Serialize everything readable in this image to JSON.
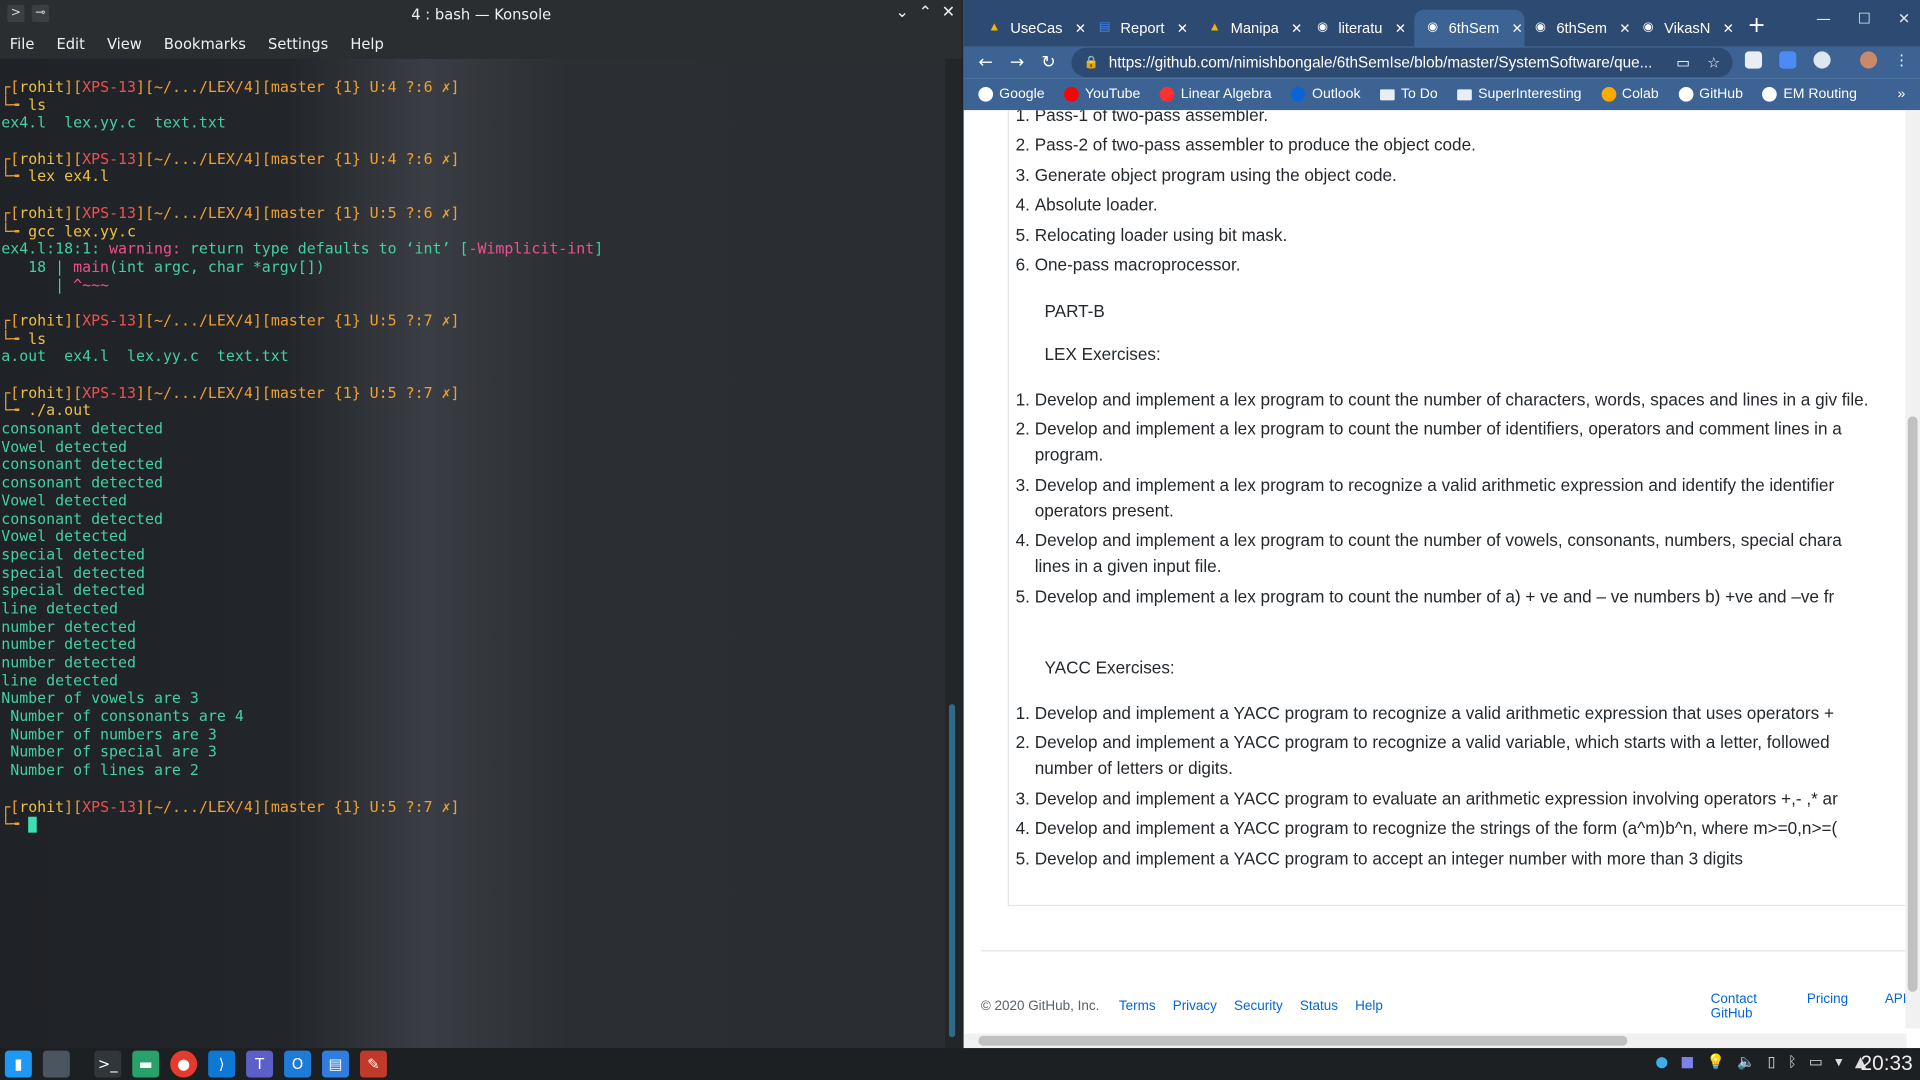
{
  "konsole": {
    "title": "4 : bash — Konsole",
    "menu": [
      "File",
      "Edit",
      "View",
      "Bookmarks",
      "Settings",
      "Help"
    ],
    "prompt": {
      "user": "rohit",
      "host": "XPS-13",
      "path": "~/.../LEX/4",
      "branch_prefix": "master {1}"
    },
    "blocks": [
      {
        "git": "U:4 ?:6",
        "cmd": "ls",
        "output": [
          {
            "t": "ex4.l  lex.yy.c  text.txt",
            "c": "c-grn"
          }
        ]
      },
      {
        "git": "U:4 ?:6",
        "cmd": "lex ex4.l",
        "output": []
      },
      {
        "git": "U:5 ?:6",
        "cmd": "gcc lex.yy.c",
        "output": []
      },
      {
        "git": "U:5 ?:7",
        "cmd": "ls",
        "output": [
          {
            "t": "a.out  ex4.l  lex.yy.c  text.txt",
            "c": "c-grn"
          }
        ]
      },
      {
        "git": "U:5 ?:7",
        "cmd": "./a.out",
        "output": [
          {
            "t": "consonant detected",
            "c": "c-grn"
          },
          {
            "t": "Vowel detected",
            "c": "c-grn"
          },
          {
            "t": "consonant detected",
            "c": "c-grn"
          },
          {
            "t": "consonant detected",
            "c": "c-grn"
          },
          {
            "t": "Vowel detected",
            "c": "c-grn"
          },
          {
            "t": "consonant detected",
            "c": "c-grn"
          },
          {
            "t": "Vowel detected",
            "c": "c-grn"
          },
          {
            "t": "special detected",
            "c": "c-grn"
          },
          {
            "t": "special detected",
            "c": "c-grn"
          },
          {
            "t": "special detected",
            "c": "c-grn"
          },
          {
            "t": "line detected",
            "c": "c-grn"
          },
          {
            "t": "number detected",
            "c": "c-grn"
          },
          {
            "t": "number detected",
            "c": "c-grn"
          },
          {
            "t": "number detected",
            "c": "c-grn"
          },
          {
            "t": "line detected",
            "c": "c-grn"
          },
          {
            "t": "Number of vowels are 3",
            "c": "c-grn"
          },
          {
            "t": " Number of consonants are 4",
            "c": "c-grn"
          },
          {
            "t": " Number of numbers are 3",
            "c": "c-grn"
          },
          {
            "t": " Number of special are 3",
            "c": "c-grn"
          },
          {
            "t": " Number of lines are 2",
            "c": "c-grn"
          }
        ]
      },
      {
        "git": "U:5 ?:7",
        "cmd": "",
        "output": [],
        "cursor": true
      }
    ],
    "warning": {
      "loc": "ex4.l:18:1:",
      "label": " warning:",
      "msg": " return type defaults to ‘int’ [",
      "flag": "-Wimplicit-int",
      "close": "]",
      "line_no": "   18 | ",
      "code_main": "main",
      "code_rest": "(int argc, char *argv[])",
      "caret_pipe": "      | ",
      "caret": "^~~~"
    }
  },
  "chrome": {
    "tabs": [
      {
        "label": "UseCas",
        "color": "#f4b400"
      },
      {
        "label": "Report",
        "color": "#4285f4"
      },
      {
        "label": "Manipa",
        "color": "#f4b400"
      },
      {
        "label": "literatu",
        "color": "#ffffff"
      },
      {
        "label": "6thSem",
        "color": "#ffffff",
        "active": true
      },
      {
        "label": "6thSem",
        "color": "#ffffff"
      },
      {
        "label": "VikasN",
        "color": "#ffffff"
      }
    ],
    "url": "https://github.com/nimishbongale/6thSemIse/blob/master/SystemSoftware/que...",
    "bookmarks": [
      {
        "label": "Google",
        "color": "#ffffff"
      },
      {
        "label": "YouTube",
        "color": "#ff0000"
      },
      {
        "label": "Linear Algebra",
        "color": "#ff3030"
      },
      {
        "label": "Outlook",
        "color": "#0a64d8"
      },
      {
        "label": "To Do",
        "folder": true
      },
      {
        "label": "SuperInteresting",
        "folder": true
      },
      {
        "label": "Colab",
        "color": "#f9ab00"
      },
      {
        "label": "GitHub",
        "color": "#ffffff"
      },
      {
        "label": "EM Routing",
        "color": "#ffffff"
      }
    ],
    "partA_items": [
      "Pass-1 of two-pass assembler.",
      "Pass-2 of two-pass assembler to produce the object code.",
      "Generate object program using the object code.",
      "Absolute loader.",
      "Relocating loader using bit mask.",
      "One-pass macroprocessor."
    ],
    "part_b": "PART-B",
    "lex_heading": "LEX Exercises:",
    "lex_items": [
      "Develop and implement a lex program to count the number of characters, words, spaces and lines in a giv file.",
      "Develop and implement a lex program to count the number of identifiers, operators and comment lines in a program.",
      "Develop and implement a lex program to recognize a valid arithmetic expression and identify the identifier operators present.",
      "Develop and implement a lex program to count the number of vowels, consonants, numbers, special chara lines in a given input file.",
      "Develop and implement a lex program to count the number of a) + ve and – ve numbers b) +ve and –ve fr"
    ],
    "yacc_heading": "YACC Exercises:",
    "yacc_items": [
      "Develop and implement a YACC program to recognize a valid arithmetic expression that uses operators +",
      "Develop and implement a YACC program to recognize a valid variable, which starts with a letter, followed number of letters or digits.",
      "Develop and implement a YACC program to evaluate an arithmetic expression involving operators +,- ,* ar",
      "Develop and implement a YACC program to recognize the strings of the form (a^m)b^n, where m>=0,n>=(",
      "Develop and implement a YACC program to accept an integer number with more than 3 digits"
    ],
    "footer": {
      "copyright": "© 2020 GitHub, Inc.",
      "links_left": [
        "Terms",
        "Privacy",
        "Security",
        "Status",
        "Help"
      ],
      "links_right": [
        "Contact GitHub",
        "Pricing",
        "API"
      ]
    }
  },
  "taskbar": {
    "clock": "20:33"
  }
}
